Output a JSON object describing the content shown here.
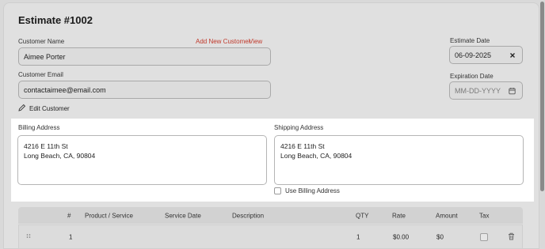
{
  "estimate": {
    "title": "Estimate #1002"
  },
  "customer": {
    "name_label": "Customer Name",
    "add_new_label": "Add New Customer",
    "view_label": "View",
    "name_value": "Aimee Porter",
    "email_label": "Customer Email",
    "email_value": "contactaimee@email.com",
    "edit_label": "Edit Customer"
  },
  "dates": {
    "estimate_label": "Estimate Date",
    "estimate_value": "06-09-2025",
    "expiration_label": "Expiration Date",
    "expiration_placeholder": "MM-DD-YYYY"
  },
  "billing": {
    "label": "Billing Address",
    "line1": "4216 E 11th St",
    "line2": "Long Beach, CA, 90804"
  },
  "shipping": {
    "label": "Shipping Address",
    "line1": "4216 E 11th St",
    "line2": "Long Beach, CA, 90804",
    "use_billing_label": "Use Billing Address",
    "use_billing_checked": false
  },
  "line_items": {
    "columns": [
      "#",
      "Product / Service",
      "Service Date",
      "Description",
      "QTY",
      "Rate",
      "Amount",
      "Tax"
    ],
    "rows": [
      {
        "num": "1",
        "product": "",
        "service_date": "",
        "description": "",
        "qty": "1",
        "rate": "$0.00",
        "amount": "$0",
        "tax": false
      }
    ]
  },
  "icons": {
    "edit": "pencil-icon",
    "clear": "close-icon",
    "calendar": "calendar-icon",
    "drag": "drag-handle-icon",
    "delete": "trash-icon"
  },
  "colors": {
    "link": "#c0392b",
    "background": "#e0e0e0",
    "address_bg": "#ffffff"
  }
}
